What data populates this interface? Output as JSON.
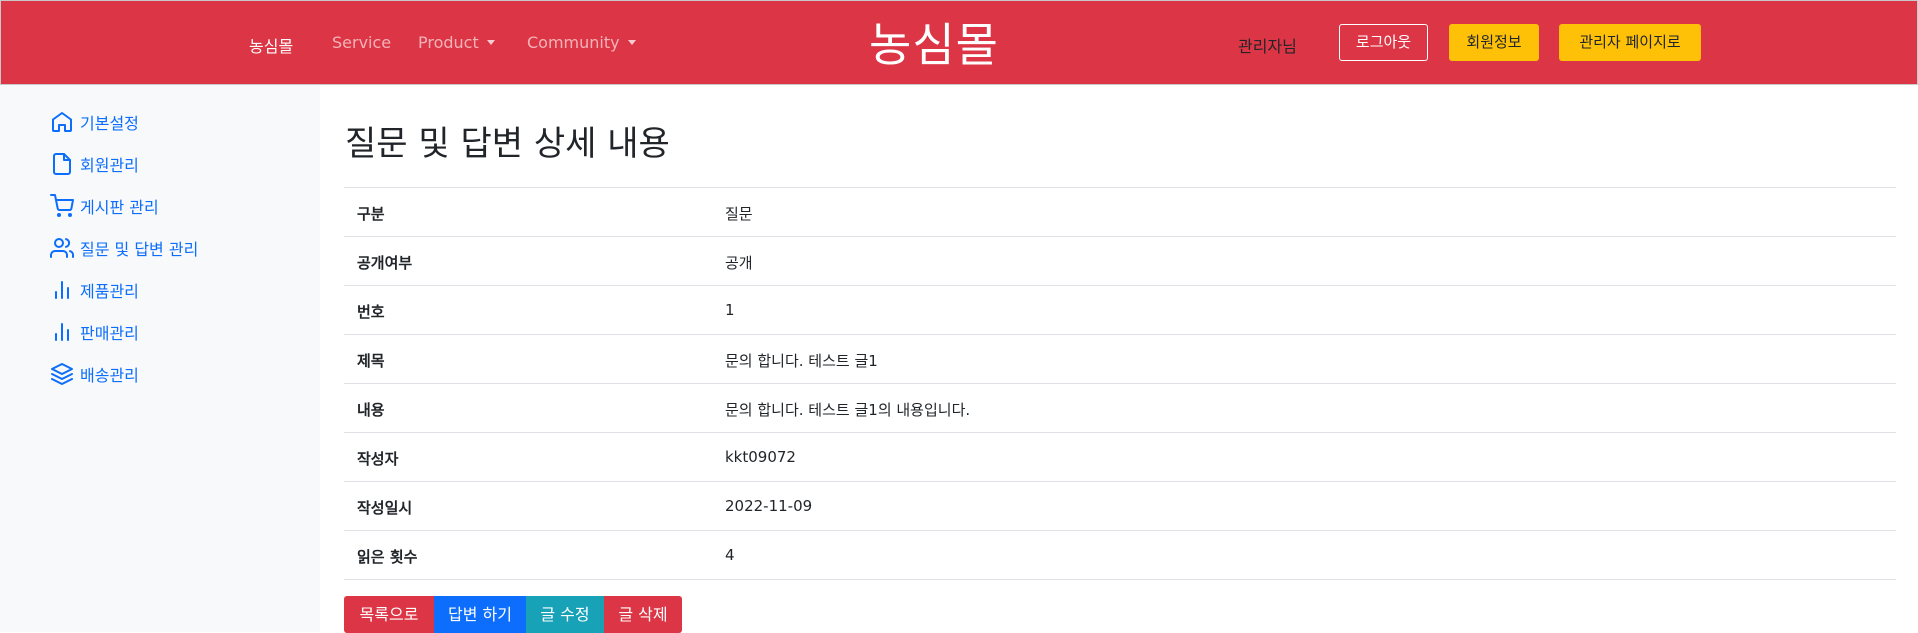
{
  "header": {
    "nav": [
      {
        "label": "농심몰"
      },
      {
        "label": "Service"
      },
      {
        "label": "Product"
      },
      {
        "label": "Community"
      }
    ],
    "brand": "농심몰",
    "user_label": "관리자님",
    "logout_label": "로그아웃",
    "member_info_label": "회원정보",
    "admin_page_label": "관리자 페이지로"
  },
  "sidebar": {
    "items": [
      {
        "label": "기본설정",
        "icon": "home-icon"
      },
      {
        "label": "회원관리",
        "icon": "file-icon"
      },
      {
        "label": "게시판 관리",
        "icon": "cart-icon"
      },
      {
        "label": "질문 및 답변 관리",
        "icon": "users-icon"
      },
      {
        "label": "제품관리",
        "icon": "bar-chart-icon"
      },
      {
        "label": "판매관리",
        "icon": "bar-chart-icon"
      },
      {
        "label": "배송관리",
        "icon": "layers-icon"
      }
    ]
  },
  "main": {
    "title": "질문 및 답변 상세 내용",
    "rows": [
      {
        "label": "구분",
        "value": "질문"
      },
      {
        "label": "공개여부",
        "value": "공개"
      },
      {
        "label": "번호",
        "value": "1"
      },
      {
        "label": "제목",
        "value": "문의 합니다. 테스트 글1"
      },
      {
        "label": "내용",
        "value": "문의 합니다. 테스트 글1의 내용입니다."
      },
      {
        "label": "작성자",
        "value": "kkt09072"
      },
      {
        "label": "작성일시",
        "value": "2022-11-09"
      },
      {
        "label": "읽은 횟수",
        "value": "4"
      }
    ],
    "buttons": {
      "list": "목록으로",
      "reply": "답변 하기",
      "edit": "글 수정",
      "delete": "글 삭제"
    }
  },
  "colors": {
    "header_bg": "#dc3545",
    "sidebar_link": "#0d6efd",
    "warning": "#ffc107",
    "primary": "#0d6efd",
    "info": "#17a2b8",
    "danger": "#dc3545"
  }
}
